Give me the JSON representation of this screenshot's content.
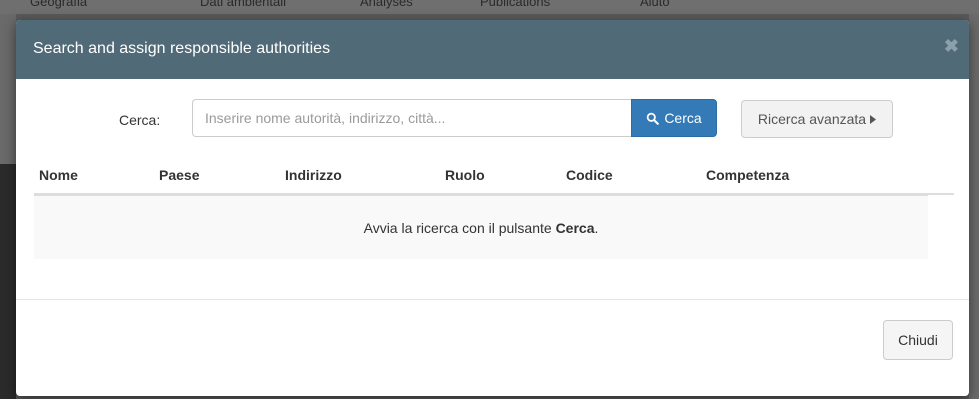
{
  "background_nav": [
    "Geografia",
    "Dati ambientali",
    "Analyses",
    "Publications",
    "Aiuto"
  ],
  "modal": {
    "title": "Search and assign responsible authorities",
    "close_icon": "✖"
  },
  "search": {
    "label": "Cerca:",
    "placeholder": "Inserire nome autorità, indirizzo, città...",
    "value": "",
    "button_label": "Cerca",
    "advanced_label": "Ricerca avanzata"
  },
  "table": {
    "headers": [
      "Nome",
      "Paese",
      "Indirizzo",
      "Ruolo",
      "Codice",
      "Competenza"
    ],
    "empty_prefix": "Avvia la ricerca con il pulsante ",
    "empty_bold": "Cerca",
    "empty_suffix": "."
  },
  "footer": {
    "close_label": "Chiudi"
  },
  "colors": {
    "header_bg": "#516a78",
    "primary": "#337ab7"
  }
}
